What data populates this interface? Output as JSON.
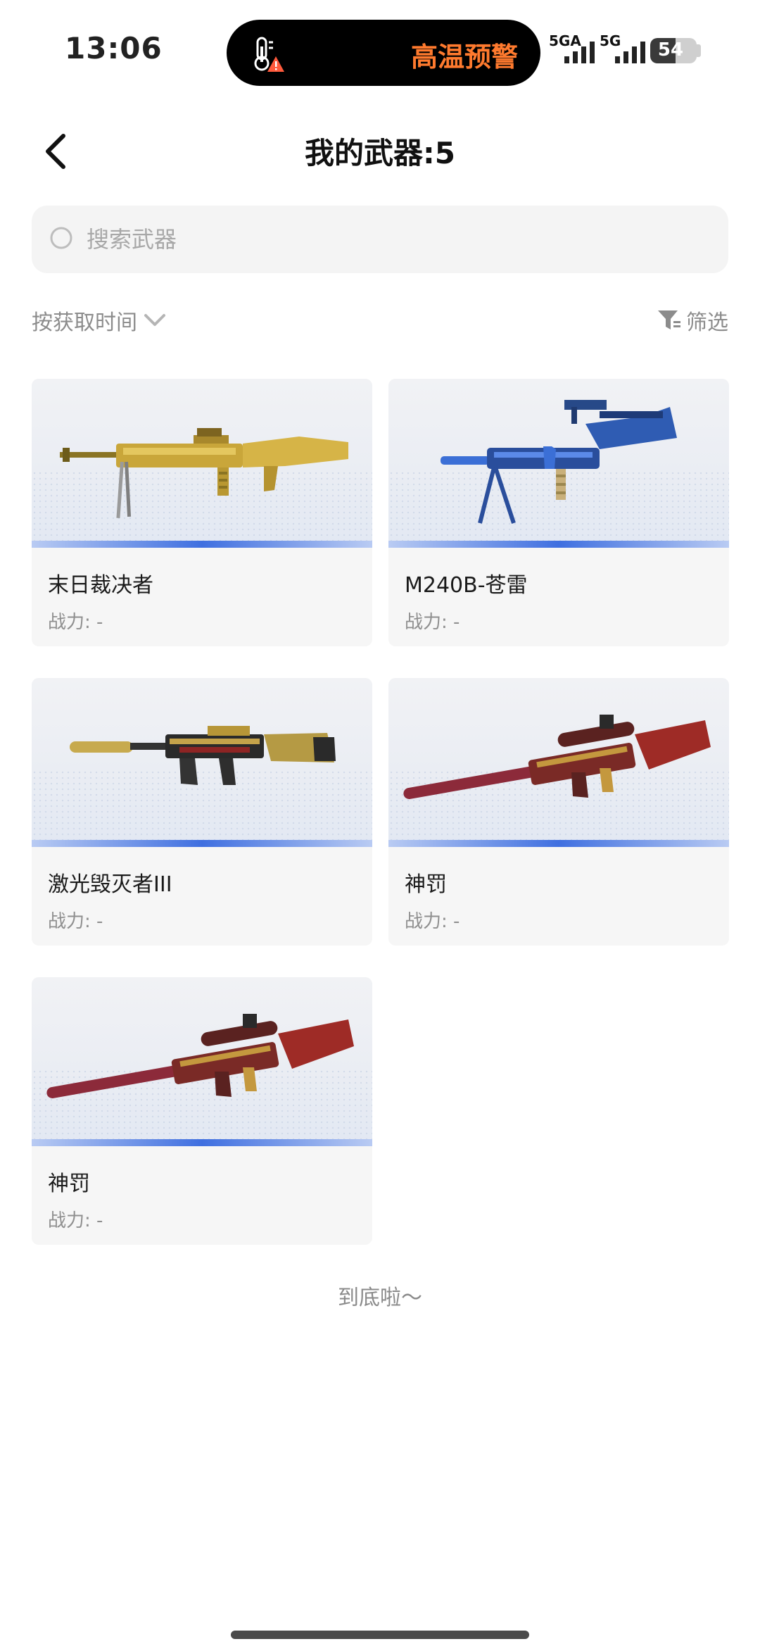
{
  "status_bar": {
    "time": "13:06",
    "alert_text": "高温预警",
    "signal_1_label": "5GA",
    "signal_2_label": "5G",
    "battery_level": "54",
    "battery_fraction": 0.54
  },
  "header": {
    "title": "我的武器:5"
  },
  "search": {
    "placeholder": "搜索武器"
  },
  "controls": {
    "sort_label": "按获取时间",
    "filter_label": "筛选"
  },
  "weapons": [
    {
      "name": "末日裁决者",
      "power": "战力: -",
      "icon": "machine-gun-gold"
    },
    {
      "name": "M240B-苍雷",
      "power": "战力: -",
      "icon": "machine-gun-blue"
    },
    {
      "name": "激光毁灭者III",
      "power": "战力: -",
      "icon": "rifle-gold-black"
    },
    {
      "name": "神罚",
      "power": "战力: -",
      "icon": "sniper-red-gold"
    },
    {
      "name": "神罚",
      "power": "战力: -",
      "icon": "sniper-red-gold"
    }
  ],
  "footer": {
    "end_text": "到底啦～"
  },
  "colors": {
    "alert": "#ff7a2e",
    "accent_band": "#3f6fe0",
    "card_bg": "#f6f6f6"
  }
}
